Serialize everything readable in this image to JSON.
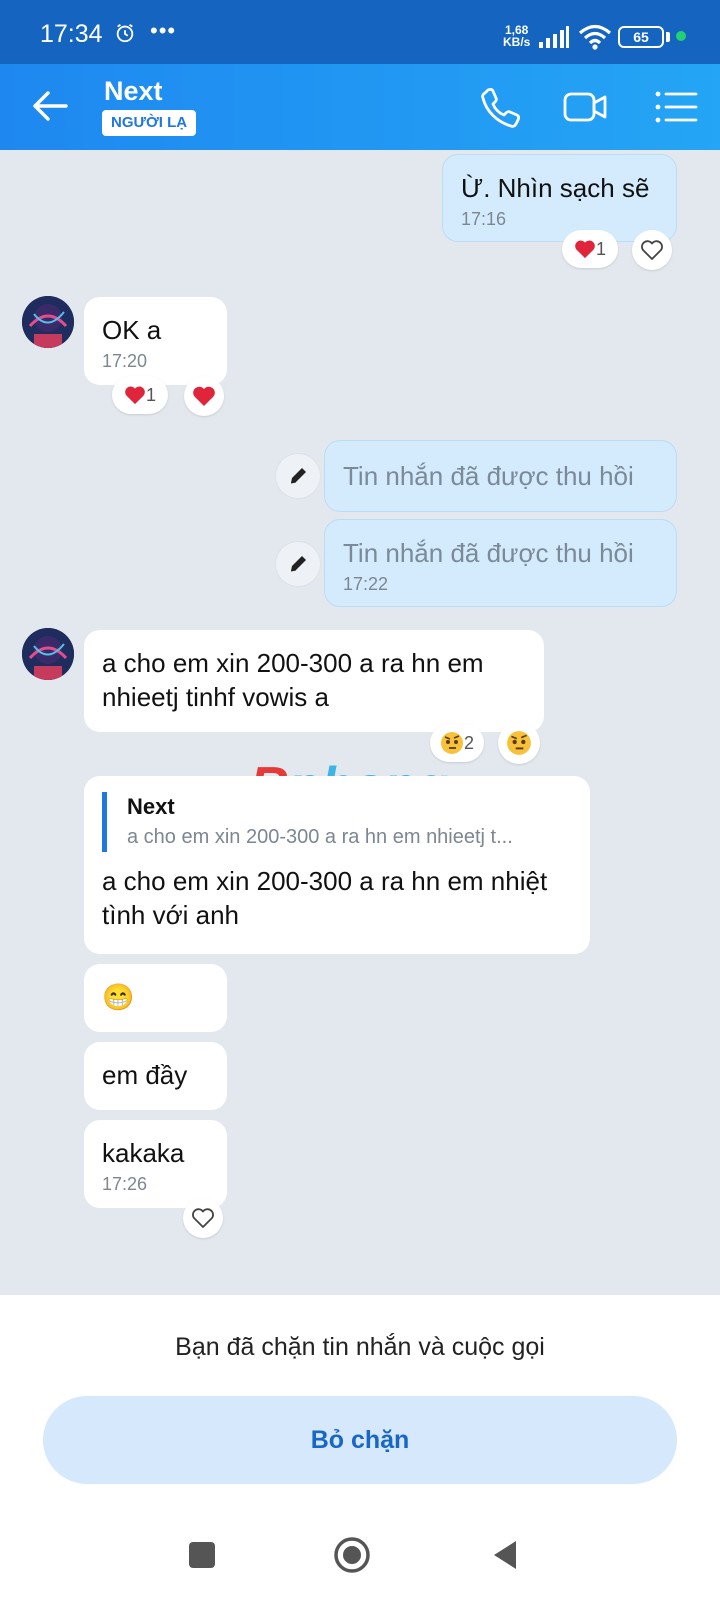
{
  "status_bar": {
    "time": "17:34",
    "more": "•••",
    "speed_value": "1,68",
    "speed_unit": "KB/s",
    "battery": "65"
  },
  "header": {
    "contact_name": "Next",
    "badge": "NGƯỜI LẠ"
  },
  "messages": {
    "m1_text": "Ừ. Nhìn sạch sẽ",
    "m1_time": "17:16",
    "m1_reaction_count": "1",
    "m2_text": "OK a",
    "m2_time": "17:20",
    "m2_reaction_count": "1",
    "m3_text": "Tin nhắn đã được thu hồi",
    "m4_text": "Tin nhắn đã được thu hồi",
    "m4_time": "17:22",
    "m5_text": "a cho em xin 200-300 a ra hn em nhieetj tinhf vowis a",
    "m5_reaction_count": "2",
    "m6_quote_name": "Next",
    "m6_quote_text": "a cho em xin 200-300 a ra hn em nhieetj t...",
    "m6_text": "a cho em xin 200-300 a ra hn em nhiệt tình với anh",
    "m7_text": "😁",
    "m8_text": "em đầy",
    "m9_text": "kakaka",
    "m9_time": "17:26"
  },
  "watermark": {
    "first": "R",
    "rest": "phang"
  },
  "blocked_panel": {
    "message": "Bạn đã chặn tin nhắn và cuộc gọi",
    "unblock_label": "Bỏ chặn"
  },
  "icons": {
    "back": "arrow-left",
    "call": "phone",
    "video": "video-camera",
    "menu": "list",
    "heart": "heart",
    "reaction_emoji": "face-with-raised-eyebrow",
    "edit": "pencil"
  },
  "colors": {
    "header_start": "#1e88f0",
    "header_end": "#24a5f5",
    "my_bubble": "#d4ebfd",
    "chat_bg": "#e3e8ef",
    "heart_red": "#e0243a",
    "unblock_bg": "#d6e8fb",
    "unblock_text": "#1866c8"
  }
}
